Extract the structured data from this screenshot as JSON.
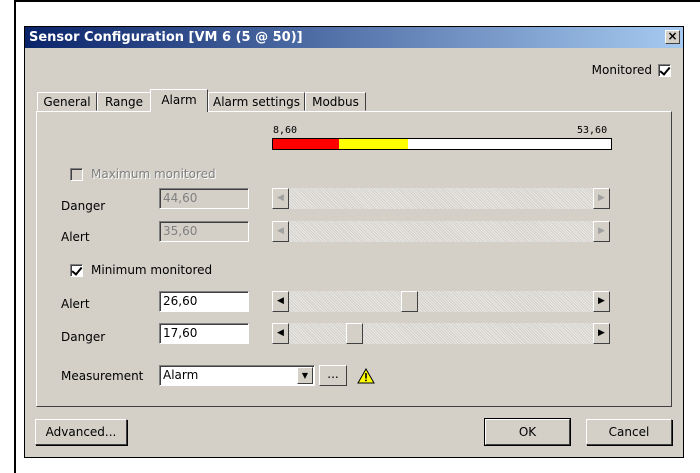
{
  "dialog": {
    "title": "Sensor Configuration [VM 6 (5 @ 50)]",
    "close_glyph": "×",
    "monitored_label": "Monitored",
    "monitored_checked": true
  },
  "tabs": [
    {
      "label": "General",
      "active": false
    },
    {
      "label": "Range",
      "active": false
    },
    {
      "label": "Alarm",
      "active": true
    },
    {
      "label": "Alarm settings",
      "active": false
    },
    {
      "label": "Modbus",
      "active": false
    }
  ],
  "range": {
    "min_label": "8,60",
    "max_label": "53,60",
    "segment_colors": [
      "#ff0000",
      "#ffff00",
      "#ffffff"
    ]
  },
  "maximum": {
    "checkbox_label": "Maximum monitored",
    "checked": false,
    "danger_label": "Danger",
    "danger_value": "44,60",
    "alert_label": "Alert",
    "alert_value": "35,60"
  },
  "minimum": {
    "checkbox_label": "Minimum monitored",
    "checked": true,
    "alert_label": "Alert",
    "alert_value": "26,60",
    "danger_label": "Danger",
    "danger_value": "17,60"
  },
  "measurement": {
    "label": "Measurement",
    "value": "Alarm",
    "dots_label": "...",
    "warning_icon": "warning-icon"
  },
  "buttons": {
    "advanced": "Advanced...",
    "ok": "OK",
    "cancel": "Cancel"
  },
  "colors": {
    "titlebar_start": "#0a246a",
    "titlebar_end": "#a6caf0",
    "danger": "#ff0000",
    "alert": "#ffff00",
    "face": "#d4d0c8"
  }
}
